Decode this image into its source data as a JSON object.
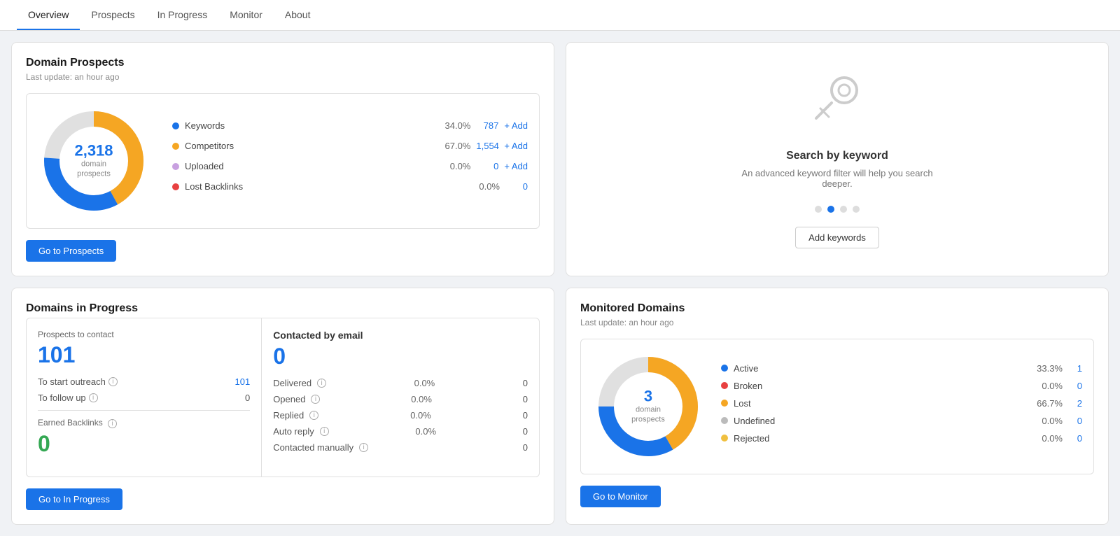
{
  "nav": {
    "items": [
      {
        "label": "Overview",
        "active": true
      },
      {
        "label": "Prospects",
        "active": false
      },
      {
        "label": "In Progress",
        "active": false
      },
      {
        "label": "Monitor",
        "active": false
      },
      {
        "label": "About",
        "active": false
      }
    ]
  },
  "domain_prospects": {
    "title": "Domain Prospects",
    "subtitle": "Last update: an hour ago",
    "donut_number": "2,318",
    "donut_label": "domain\nprospects",
    "legend": [
      {
        "label": "Keywords",
        "pct": "34.0%",
        "count": "787",
        "color": "#1a73e8",
        "has_add": true
      },
      {
        "label": "Competitors",
        "pct": "67.0%",
        "count": "1,554",
        "color": "#f5a623",
        "has_add": true
      },
      {
        "label": "Uploaded",
        "pct": "0.0%",
        "count": "0",
        "color": "#c8a0e0",
        "has_add": true
      },
      {
        "label": "Lost Backlinks",
        "pct": "0.0%",
        "count": "0",
        "color": "#e84040",
        "has_add": false
      }
    ],
    "go_button": "Go to Prospects"
  },
  "keyword_search": {
    "title": "Search by keyword",
    "description": "An advanced keyword filter will help you search deeper.",
    "dots": [
      false,
      true,
      false,
      false
    ],
    "button": "Add keywords"
  },
  "in_progress": {
    "title": "Domains in Progress",
    "prospects_to_contact": {
      "label": "Prospects to contact",
      "value": "101"
    },
    "to_start_outreach": {
      "label": "To start outreach",
      "value": "101"
    },
    "to_follow_up": {
      "label": "To follow up",
      "value": "0"
    },
    "earned_backlinks": {
      "label": "Earned Backlinks",
      "value": "0"
    },
    "contacted_by_email": {
      "label": "Contacted by email",
      "value": "0"
    },
    "email_stats": [
      {
        "label": "Delivered",
        "pct": "0.0%",
        "count": "0"
      },
      {
        "label": "Opened",
        "pct": "0.0%",
        "count": "0"
      },
      {
        "label": "Replied",
        "pct": "0.0%",
        "count": "0"
      },
      {
        "label": "Auto reply",
        "pct": "0.0%",
        "count": "0"
      },
      {
        "label": "Contacted manually",
        "pct": "",
        "count": "0"
      }
    ],
    "go_button": "Go to In Progress"
  },
  "monitored": {
    "title": "Monitored Domains",
    "subtitle": "Last update: an hour ago",
    "donut_number": "3",
    "donut_label": "domain\nprospects",
    "legend": [
      {
        "label": "Active",
        "pct": "33.3%",
        "count": "1",
        "color": "#1a73e8"
      },
      {
        "label": "Broken",
        "pct": "0.0%",
        "count": "0",
        "color": "#e84040"
      },
      {
        "label": "Lost",
        "pct": "66.7%",
        "count": "2",
        "color": "#f5a623"
      },
      {
        "label": "Undefined",
        "pct": "0.0%",
        "count": "0",
        "color": "#bbb"
      },
      {
        "label": "Rejected",
        "pct": "0.0%",
        "count": "0",
        "color": "#f0c040"
      }
    ],
    "go_button": "Go to Monitor"
  }
}
